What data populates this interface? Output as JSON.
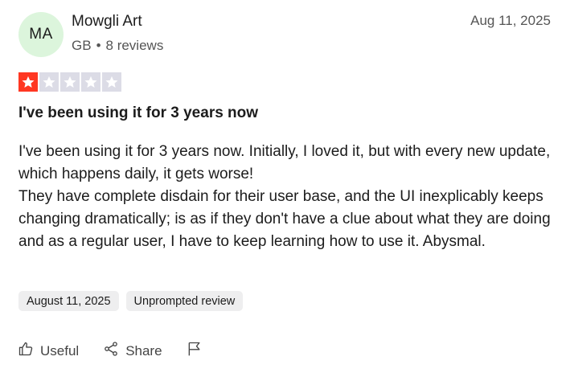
{
  "reviewer": {
    "initials": "MA",
    "name": "Mowgli Art",
    "country": "GB",
    "separator": "•",
    "reviews_count": "8 reviews",
    "avatar_color": "#dcf5dc"
  },
  "review": {
    "date": "Aug 11, 2025",
    "rating": 1,
    "max_rating": 5,
    "title": "I've been using it for 3 years now",
    "body": "I've been using it for 3 years now. Initially, I loved it, but with every new update, which happens daily, it gets worse!\nThey have complete disdain for their user base, and the UI inexplicably keeps changing dramatically; is as if they don't have a clue about what they are doing and as a regular user, I have to keep learning how to use it. Abysmal.",
    "star_color": "#ff3722",
    "empty_star_color": "#dcdce6"
  },
  "tags": {
    "experience_date": "August 11, 2025",
    "review_type": "Unprompted review"
  },
  "actions": {
    "useful_label": "Useful",
    "share_label": "Share",
    "useful_icon": "thumbs-up-icon",
    "share_icon": "share-icon",
    "report_icon": "flag-icon"
  }
}
